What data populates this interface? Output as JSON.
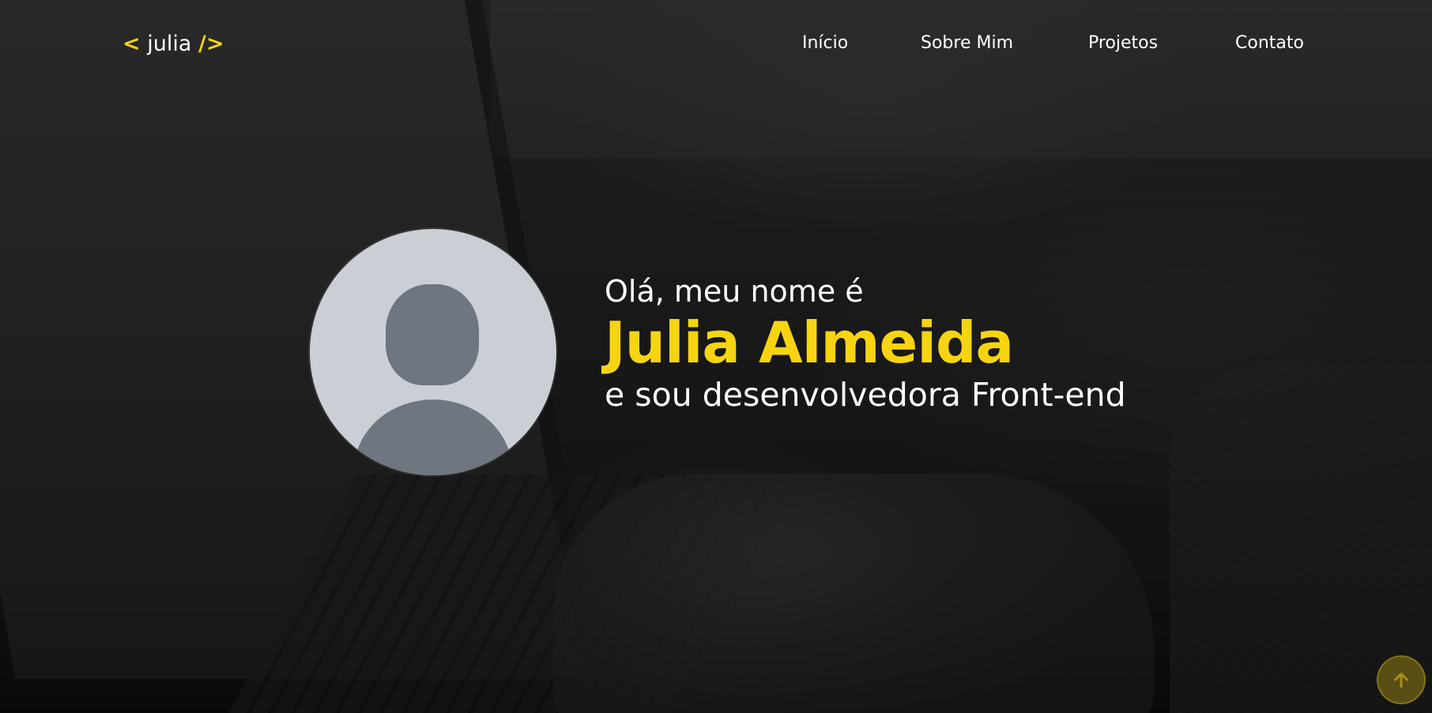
{
  "logo": {
    "open": "<",
    "name": " julia ",
    "close": "/>"
  },
  "nav": {
    "items": [
      {
        "label": "Início"
      },
      {
        "label": "Sobre Mim"
      },
      {
        "label": "Projetos"
      },
      {
        "label": "Contato"
      }
    ]
  },
  "hero": {
    "greeting": "Olá, meu nome é",
    "name": "Julia Almeida",
    "role": "e sou desenvolvedora Front-end"
  },
  "icons": {
    "avatar": "user-placeholder-icon",
    "back_to_top": "arrow-up-icon"
  },
  "colors": {
    "accent": "#f7d411",
    "text": "#ffffff",
    "avatar_bg": "#cbcfd5",
    "avatar_fg": "#6f767f"
  }
}
